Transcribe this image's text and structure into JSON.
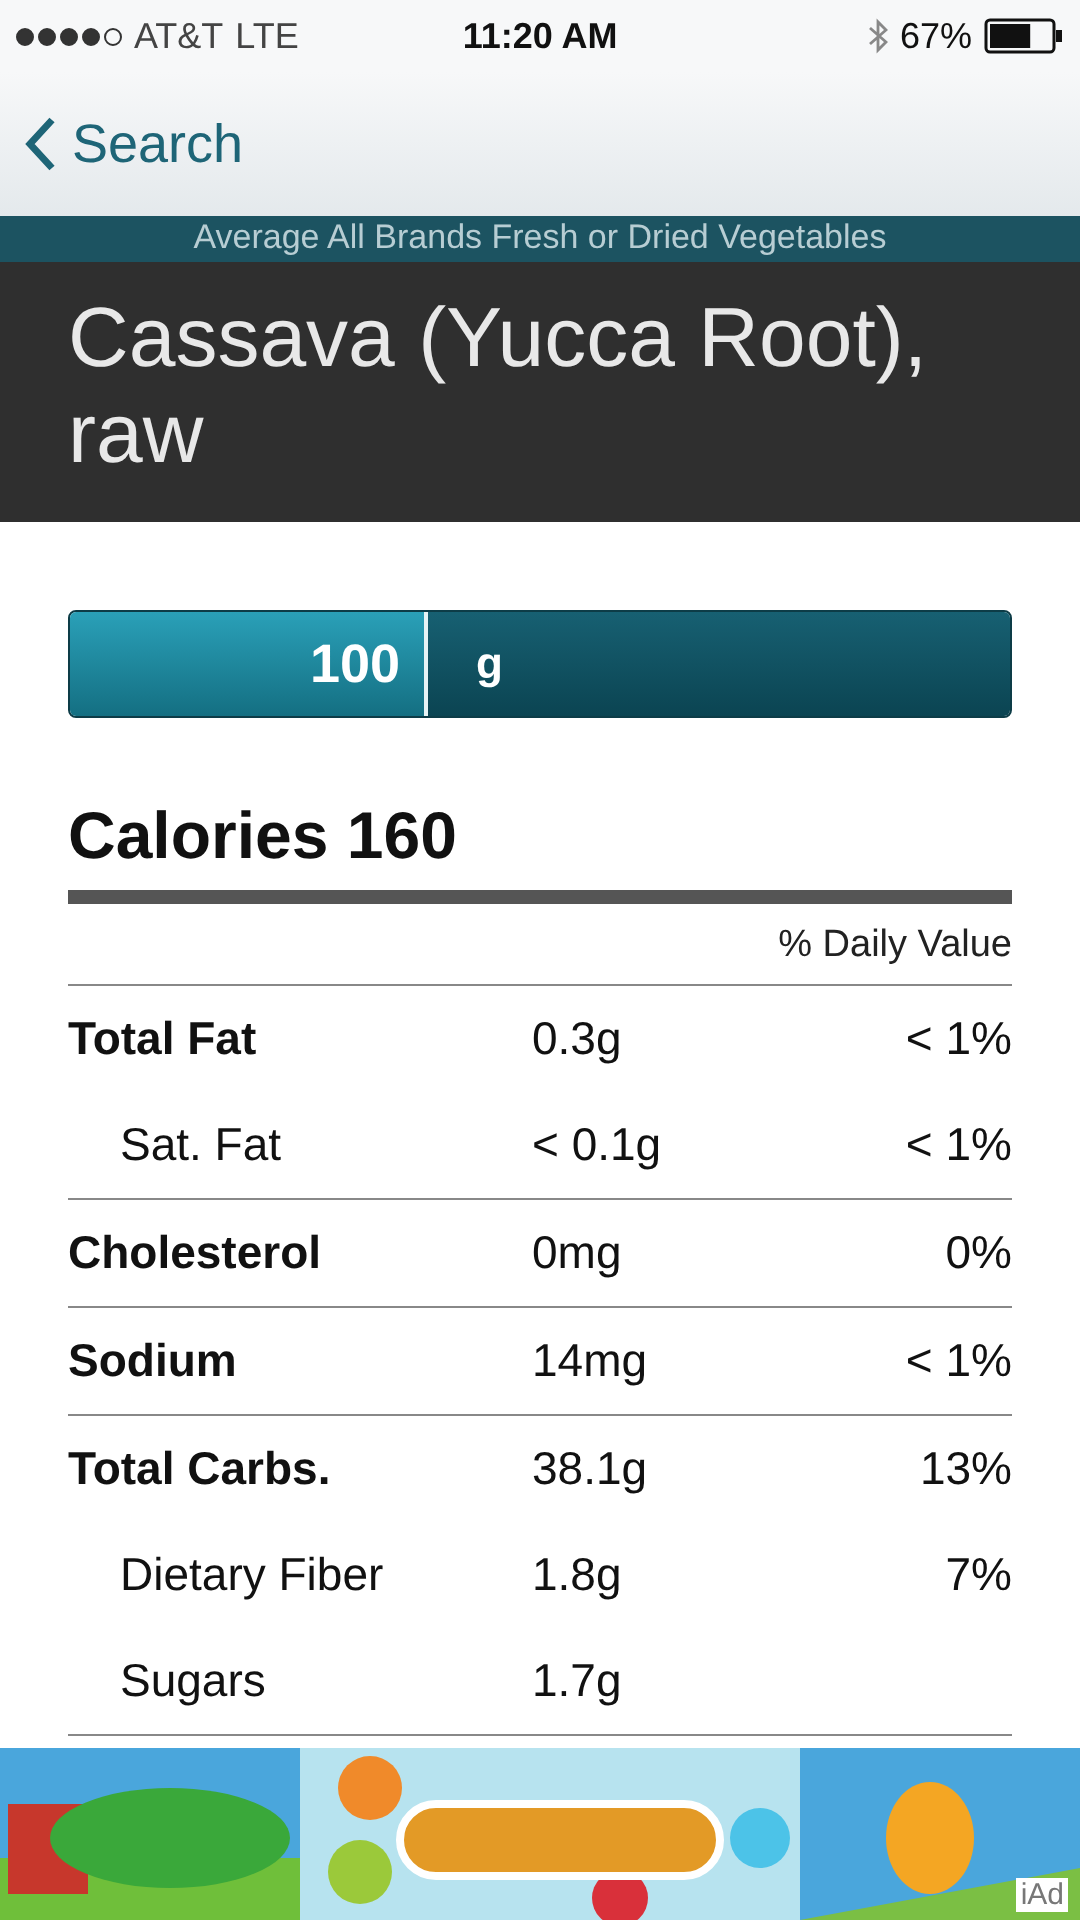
{
  "status_bar": {
    "carrier": "AT&T",
    "network": "LTE",
    "time": "11:20 AM",
    "battery": "67%"
  },
  "nav": {
    "back": "Search"
  },
  "subtitle": "Average All Brands Fresh or Dried Vegetables",
  "title": "Cassava (Yucca Root), raw",
  "serving": {
    "amount": "100",
    "unit": "g"
  },
  "calories": "Calories 160",
  "dv_header": "% Daily Value",
  "rows": [
    {
      "name": "Total Fat",
      "amount": "0.3g",
      "dv": "< 1%",
      "kind": "main"
    },
    {
      "name": "Sat. Fat",
      "amount": "< 0.1g",
      "dv": "< 1%",
      "kind": "sub"
    },
    {
      "name": "Cholesterol",
      "amount": "0mg",
      "dv": "0%",
      "kind": "main"
    },
    {
      "name": "Sodium",
      "amount": "14mg",
      "dv": "< 1%",
      "kind": "main"
    },
    {
      "name": "Total Carbs.",
      "amount": "38.1g",
      "dv": "13%",
      "kind": "main"
    },
    {
      "name": "Dietary Fiber",
      "amount": "1.8g",
      "dv": "7%",
      "kind": "sub"
    },
    {
      "name": "Sugars",
      "amount": "1.7g",
      "kind": "sub"
    }
  ],
  "ad": {
    "label": "iAd"
  }
}
